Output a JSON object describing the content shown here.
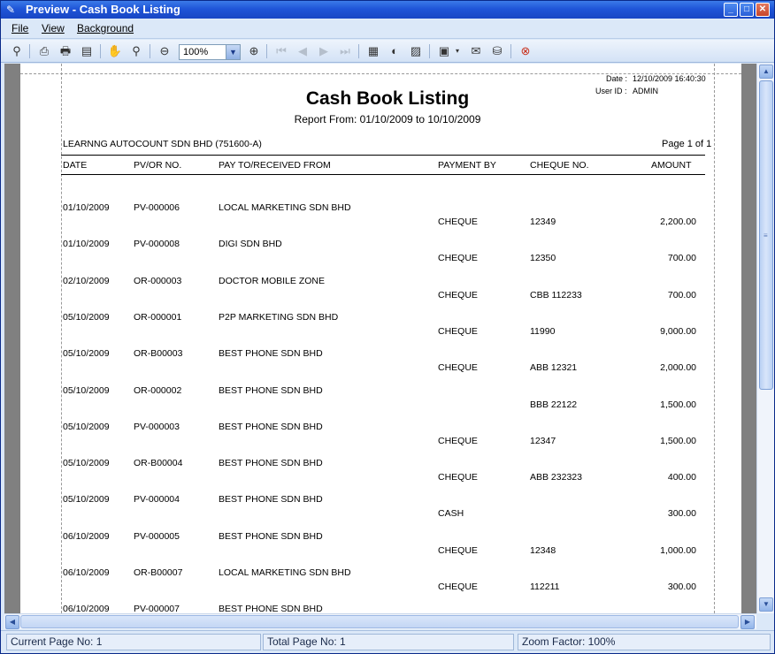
{
  "window": {
    "title": "Preview - Cash Book Listing",
    "icon": "preview-icon"
  },
  "menu": [
    "File",
    "View",
    "Background"
  ],
  "toolbar": {
    "zoom_value": "100%"
  },
  "report": {
    "date_label": "Date :",
    "date_value": "12/10/2009 16:40:30",
    "user_label": "User ID :",
    "user_value": "ADMIN",
    "title": "Cash Book Listing",
    "range": "Report From: 01/10/2009   to   10/10/2009",
    "company": "LEARNNG AUTOCOUNT SDN BHD (751600-A)",
    "page": "Page 1 of 1",
    "headers": {
      "date": "DATE",
      "doc": "PV/OR NO.",
      "payto": "PAY TO/RECEIVED FROM",
      "payment": "PAYMENT BY",
      "cheque": "CHEQUE NO.",
      "amount": "AMOUNT"
    },
    "rows": [
      {
        "date": "01/10/2009",
        "doc": "PV-000006",
        "payto": "LOCAL MARKETING SDN BHD",
        "payment": "CHEQUE",
        "cheque": "12349",
        "amount": "2,200.00"
      },
      {
        "date": "01/10/2009",
        "doc": "PV-000008",
        "payto": "DIGI SDN BHD",
        "payment": "CHEQUE",
        "cheque": "12350",
        "amount": "700.00"
      },
      {
        "date": "02/10/2009",
        "doc": "OR-000003",
        "payto": "DOCTOR MOBILE ZONE",
        "payment": "CHEQUE",
        "cheque": "CBB 112233",
        "amount": "700.00"
      },
      {
        "date": "05/10/2009",
        "doc": "OR-000001",
        "payto": "P2P MARKETING SDN BHD",
        "payment": "CHEQUE",
        "cheque": "11990",
        "amount": "9,000.00"
      },
      {
        "date": "05/10/2009",
        "doc": "OR-B00003",
        "payto": "BEST PHONE SDN BHD",
        "payment": "CHEQUE",
        "cheque": "ABB 12321",
        "amount": "2,000.00"
      },
      {
        "date": "05/10/2009",
        "doc": "OR-000002",
        "payto": "BEST PHONE SDN BHD",
        "payment": "",
        "cheque": "BBB 22122",
        "amount": "1,500.00"
      },
      {
        "date": "05/10/2009",
        "doc": "PV-000003",
        "payto": "BEST PHONE SDN BHD",
        "payment": "CHEQUE",
        "cheque": "12347",
        "amount": "1,500.00"
      },
      {
        "date": "05/10/2009",
        "doc": "OR-B00004",
        "payto": "BEST PHONE SDN BHD",
        "payment": "CHEQUE",
        "cheque": "ABB 232323",
        "amount": "400.00"
      },
      {
        "date": "05/10/2009",
        "doc": "PV-000004",
        "payto": "BEST PHONE SDN BHD",
        "payment": "CASH",
        "cheque": "",
        "amount": "300.00"
      },
      {
        "date": "06/10/2009",
        "doc": "PV-000005",
        "payto": "BEST PHONE SDN BHD",
        "payment": "CHEQUE",
        "cheque": "12348",
        "amount": "1,000.00"
      },
      {
        "date": "06/10/2009",
        "doc": "OR-B00007",
        "payto": "LOCAL MARKETING SDN BHD",
        "payment": "CHEQUE",
        "cheque": "112211",
        "amount": "300.00"
      },
      {
        "date": "06/10/2009",
        "doc": "PV-000007",
        "payto": "BEST PHONE SDN BHD",
        "payment": "",
        "cheque": "",
        "amount": ""
      }
    ]
  },
  "status": {
    "current_page": "Current Page No: 1",
    "total_page": "Total Page No: 1",
    "zoom_factor": "Zoom Factor: 100%"
  }
}
